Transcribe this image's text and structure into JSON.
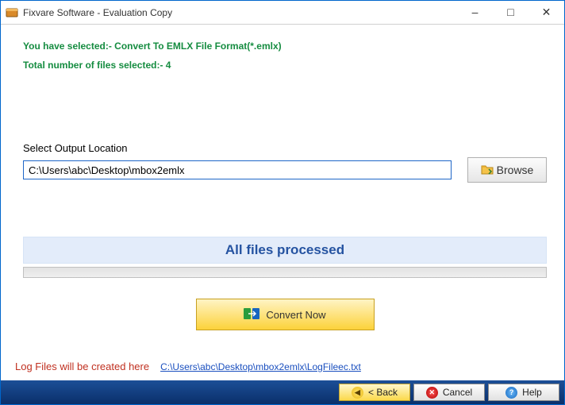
{
  "titlebar": {
    "title": "Fixvare Software - Evaluation Copy"
  },
  "info": {
    "selected_format": "You have selected:- Convert To EMLX File Format(*.emlx)",
    "total_files": "Total number of files selected:- 4"
  },
  "output": {
    "label": "Select Output Location",
    "path": "C:\\Users\\abc\\Desktop\\mbox2emlx",
    "browse_label": "Browse"
  },
  "status": {
    "message": "All files processed"
  },
  "actions": {
    "convert_label": "Convert Now"
  },
  "log": {
    "label": "Log Files will be created here",
    "path": "C:\\Users\\abc\\Desktop\\mbox2emlx\\LogFileec.txt"
  },
  "nav": {
    "back_label": "< Back",
    "cancel_label": "Cancel",
    "help_label": "Help"
  }
}
